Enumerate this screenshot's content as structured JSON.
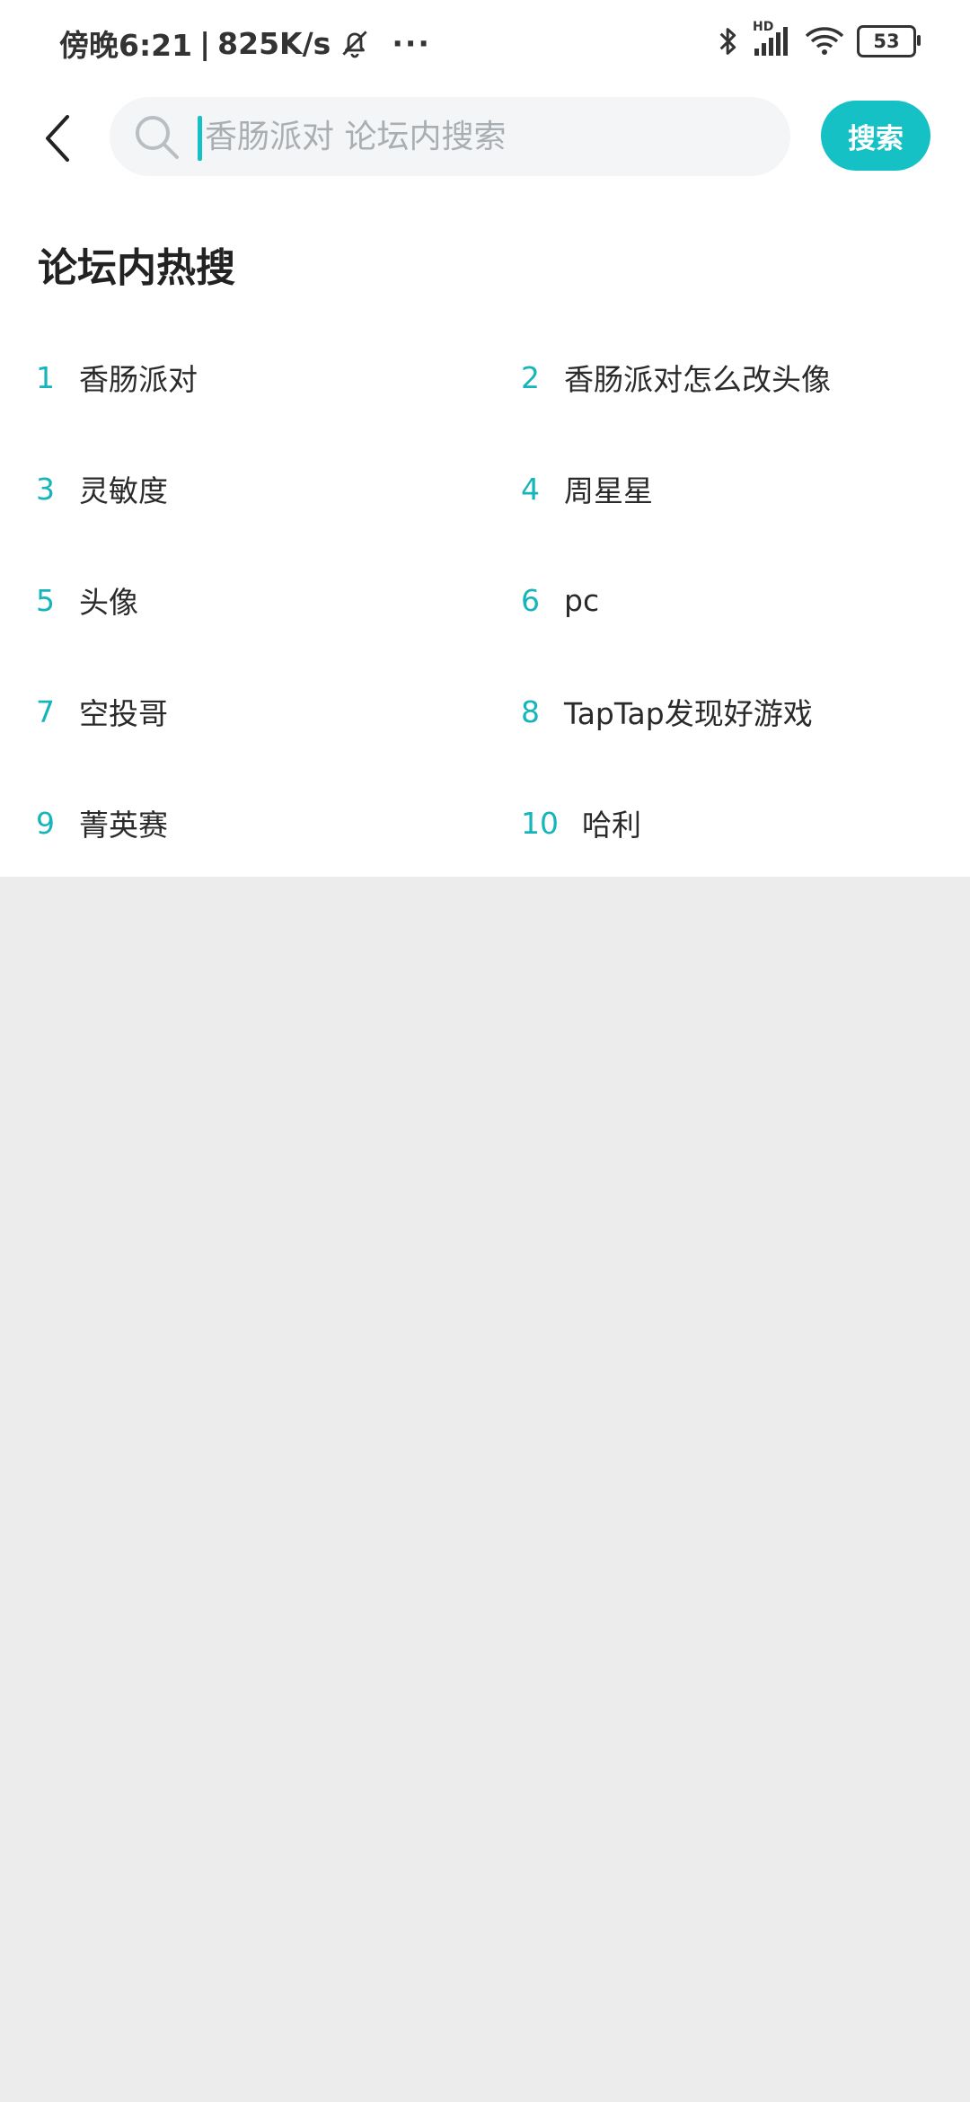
{
  "statusbar": {
    "time": "傍晚6:21",
    "separator": "|",
    "network_speed": "825K/s",
    "more": "···",
    "hd_label": "HD",
    "battery": "53"
  },
  "search": {
    "placeholder": "香肠派对 论坛内搜索",
    "value": "",
    "button_label": "搜索"
  },
  "section": {
    "title": "论坛内热搜"
  },
  "hot_searches": [
    {
      "rank": "1",
      "term": "香肠派对"
    },
    {
      "rank": "2",
      "term": "香肠派对怎么改头像"
    },
    {
      "rank": "3",
      "term": "灵敏度"
    },
    {
      "rank": "4",
      "term": "周星星"
    },
    {
      "rank": "5",
      "term": "头像"
    },
    {
      "rank": "6",
      "term": "pc"
    },
    {
      "rank": "7",
      "term": "空投哥"
    },
    {
      "rank": "8",
      "term": "TapTap发现好游戏"
    },
    {
      "rank": "9",
      "term": "菁英赛"
    },
    {
      "rank": "10",
      "term": "哈利"
    }
  ],
  "colors": {
    "accent": "#16c1c6",
    "rank_text": "#16b5bb",
    "page_bg": "#ececec",
    "search_bg": "#f4f5f6"
  },
  "icons": {
    "back": "chevron-left-icon",
    "search": "search-icon",
    "mute": "bell-off-icon",
    "bluetooth": "bluetooth-icon",
    "signal": "cell-signal-icon",
    "wifi": "wifi-icon"
  }
}
